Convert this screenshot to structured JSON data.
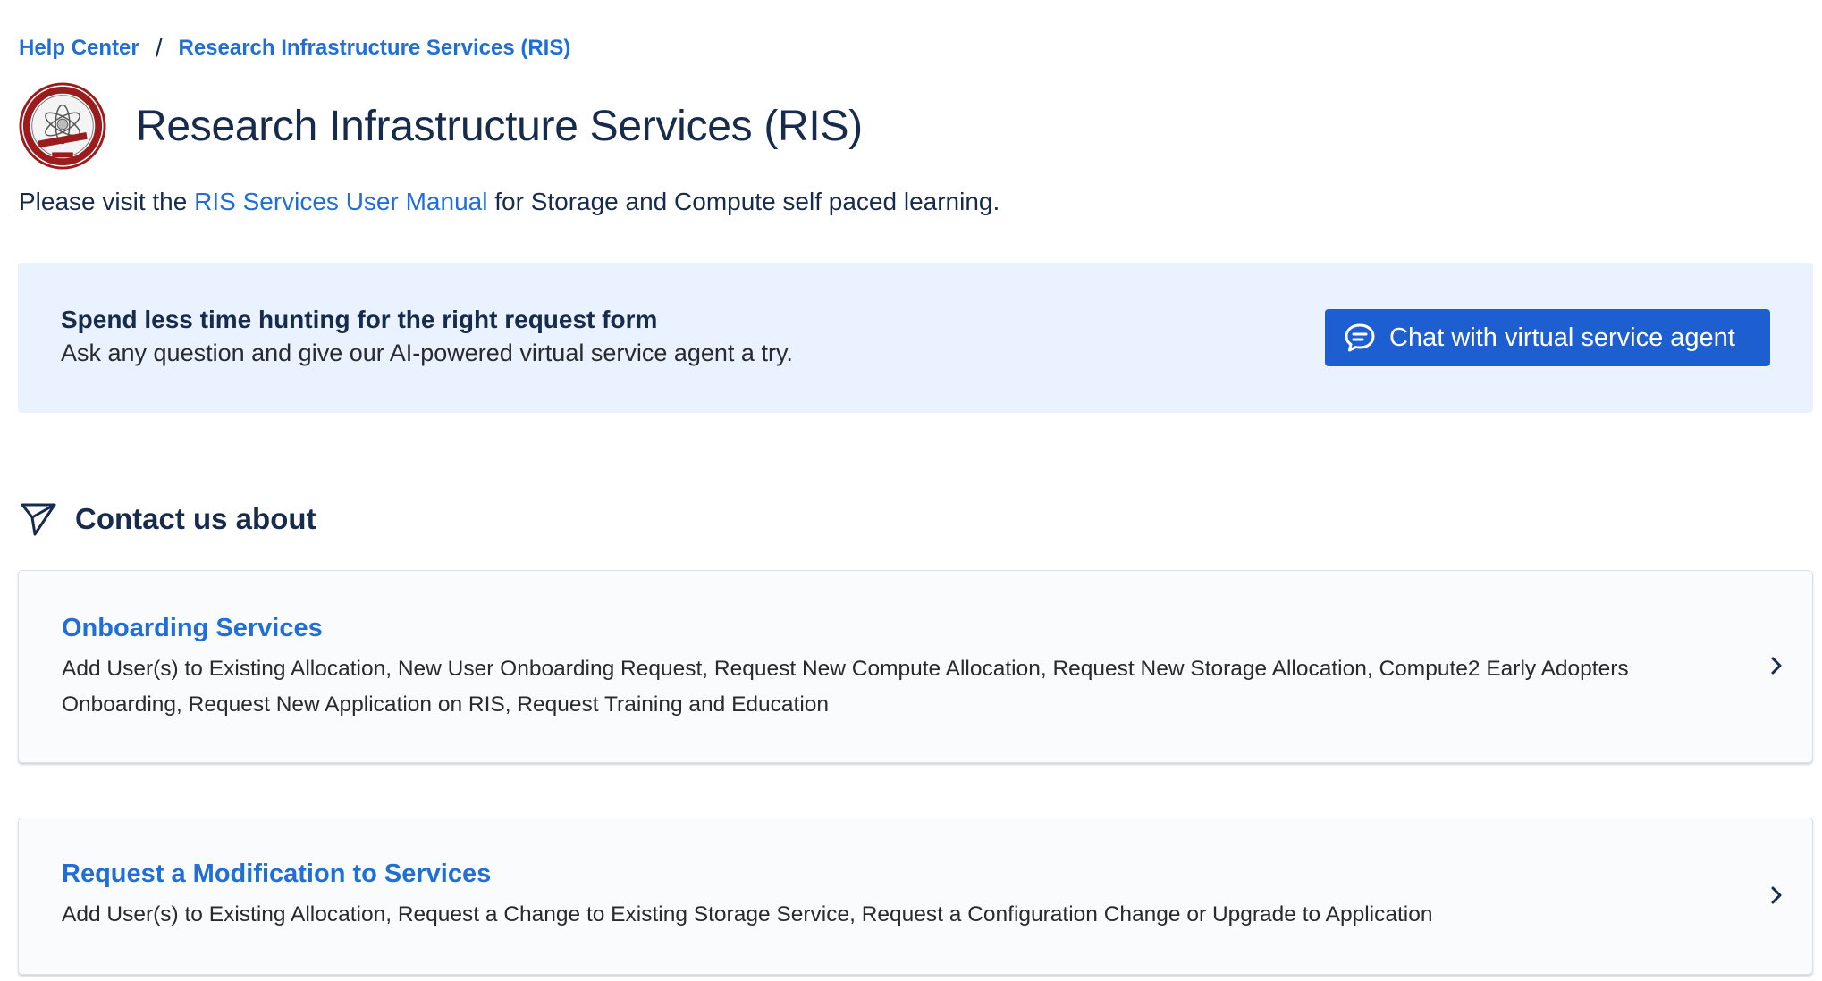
{
  "breadcrumb": {
    "home": "Help Center",
    "separator": "/",
    "current": "Research Infrastructure Services (RIS)"
  },
  "header": {
    "title": "Research Infrastructure Services (RIS)",
    "logo_icon": "ris-seal-logo"
  },
  "intro": {
    "prefix": "Please visit the ",
    "link": "RIS Services User Manual",
    "suffix": " for Storage and Compute self paced learning."
  },
  "banner": {
    "title": "Spend less time hunting for the right request form",
    "subtitle": "Ask any question and give our AI-powered virtual service agent a try.",
    "button_label": "Chat with virtual service agent",
    "button_icon": "chat-bubble-icon",
    "background": "#e9f2fe",
    "button_color": "#1d5fd0"
  },
  "contact": {
    "title": "Contact us about",
    "icon": "paper-plane-icon",
    "cards": [
      {
        "title": "Onboarding Services",
        "description": "Add User(s) to Existing Allocation, New User Onboarding Request, Request New Compute Allocation, Request New Storage Allocation, Compute2 Early Adopters Onboarding, Request New Application on RIS, Request Training and Education"
      },
      {
        "title": "Request a Modification to Services",
        "description": "Add User(s) to Existing Allocation, Request a Change to Existing Storage Service, Request a Configuration Change or Upgrade to Application"
      }
    ]
  },
  "colors": {
    "link": "#1f6fd6",
    "text": "#172b4d"
  }
}
